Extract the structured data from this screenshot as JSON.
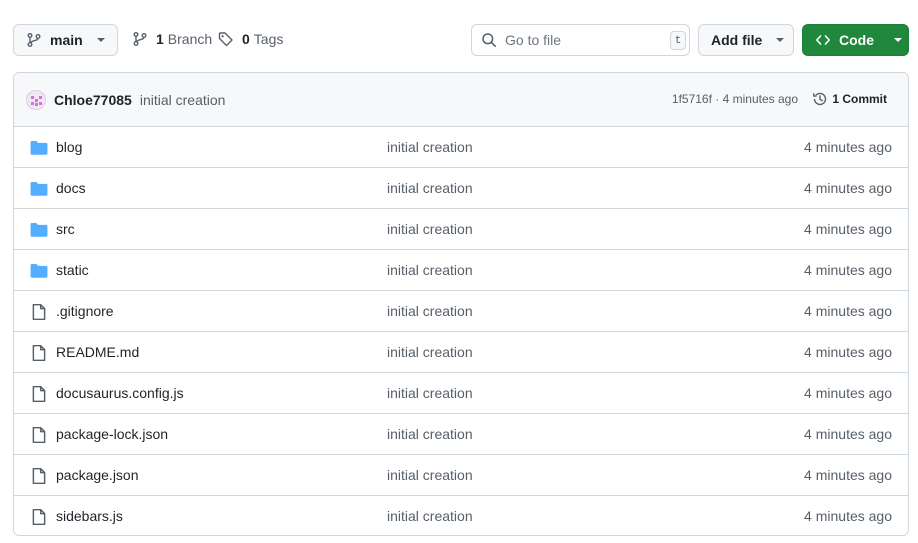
{
  "toolbar": {
    "branch_label": "main",
    "branches_count": "1",
    "branches_text": "Branch",
    "tags_count": "0",
    "tags_text": "Tags",
    "search_placeholder": "Go to file",
    "search_shortcut": "t",
    "add_file_label": "Add file",
    "code_label": "Code"
  },
  "latest_commit": {
    "author": "Chloe77085",
    "message": "initial creation",
    "meta": "1f5716f · 4 minutes ago",
    "commit_count": "1 Commit"
  },
  "files": [
    {
      "name": "blog",
      "type": "folder",
      "message": "initial creation",
      "age": "4 minutes ago"
    },
    {
      "name": "docs",
      "type": "folder",
      "message": "initial creation",
      "age": "4 minutes ago"
    },
    {
      "name": "src",
      "type": "folder",
      "message": "initial creation",
      "age": "4 minutes ago"
    },
    {
      "name": "static",
      "type": "folder",
      "message": "initial creation",
      "age": "4 minutes ago"
    },
    {
      "name": ".gitignore",
      "type": "file",
      "message": "initial creation",
      "age": "4 minutes ago"
    },
    {
      "name": "README.md",
      "type": "file",
      "message": "initial creation",
      "age": "4 minutes ago"
    },
    {
      "name": "docusaurus.config.js",
      "type": "file",
      "message": "initial creation",
      "age": "4 minutes ago"
    },
    {
      "name": "package-lock.json",
      "type": "file",
      "message": "initial creation",
      "age": "4 minutes ago"
    },
    {
      "name": "package.json",
      "type": "file",
      "message": "initial creation",
      "age": "4 minutes ago"
    },
    {
      "name": "sidebars.js",
      "type": "file",
      "message": "initial creation",
      "age": "4 minutes ago"
    }
  ],
  "colors": {
    "folder_icon": "#54aeff",
    "file_icon": "#57606a",
    "code_button": "#1f883d"
  }
}
